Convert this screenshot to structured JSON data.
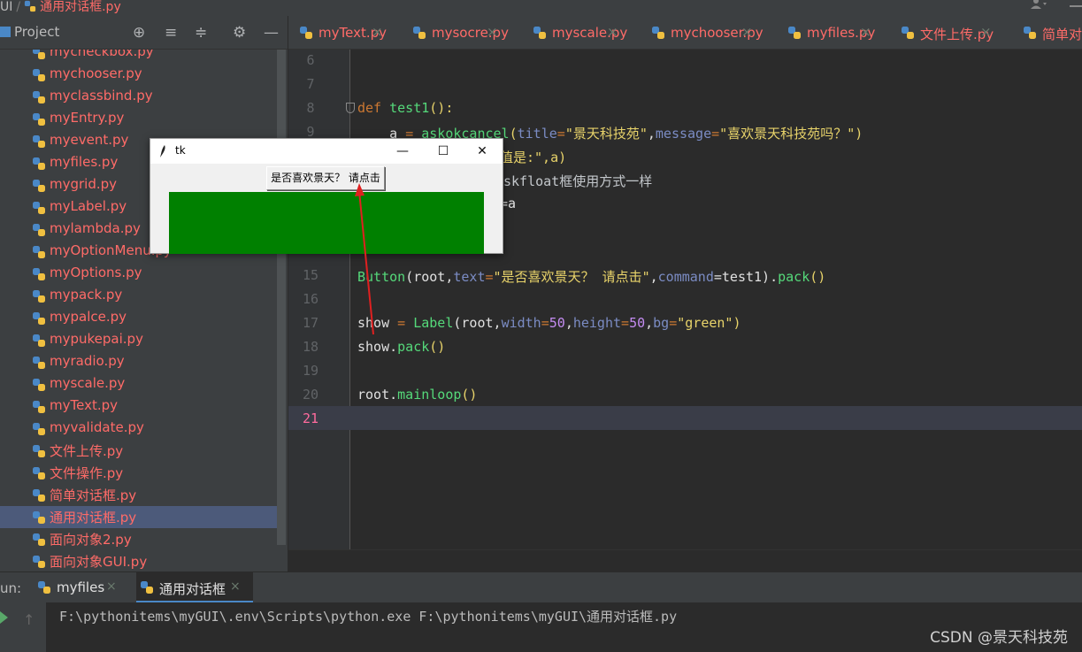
{
  "breadcrumb": {
    "project": "UI",
    "separator": "/",
    "file": "通用对话框.py"
  },
  "project_panel": {
    "title": "Project",
    "files": [
      "mycheckbox.py",
      "mychooser.py",
      "myclassbind.py",
      "myEntry.py",
      "myevent.py",
      "myfiles.py",
      "mygrid.py",
      "myLabel.py",
      "mylambda.py",
      "myOptionMenu.py",
      "myOptions.py",
      "mypack.py",
      "mypalce.py",
      "mypukepai.py",
      "myradio.py",
      "myscale.py",
      "myText.py",
      "myvalidate.py",
      "文件上传.py",
      "文件操作.py",
      "简单对话框.py",
      "通用对话框.py",
      "面向对象2.py",
      "面向对象GUI.py"
    ],
    "selected": "通用对话框.py"
  },
  "editor_tabs": [
    "myText.py",
    "mysocre.py",
    "myscale.py",
    "mychooser.py",
    "myfiles.py",
    "文件上传.py",
    "简单对话"
  ],
  "tab_close_glyph": "×",
  "gutter_lines": [
    "6",
    "7",
    "8",
    "9",
    "15",
    "16",
    "17",
    "18",
    "19",
    "20",
    "21"
  ],
  "current_line": "21",
  "code": {
    "l8_def": "def ",
    "l8_name": "test1",
    "l8_rest": "():",
    "l9_a": "    a ",
    "l9_eq": "= ",
    "l9_fn": "askokcancel",
    "l9_p1": "title",
    "l9_s1": "\"景天科技苑\"",
    "l9_p2": "message",
    "l9_s2": "\"喜欢景天科技苑吗？\"",
    "l10_tail": "值是:\",a)",
    "l11_tail": "skfloat框使用方式一样",
    "l12_tail": "=a",
    "l15_btn": "Button",
    "l15_root": "(root,",
    "l15_p1": "text",
    "l15_s1": "\"是否喜欢景天？ 请点击\"",
    "l15_p2": "command",
    "l15_cmd": "=test1).",
    "l15_pack": "pack",
    "l15_end": "()",
    "l17_show": "show ",
    "l17_eq": "= ",
    "l17_label": "Label",
    "l17_root": "(root,",
    "l17_w": "width",
    "l17_wv": "50",
    "l17_h": "height",
    "l17_hv": "50",
    "l17_bg": "bg",
    "l17_bgv": "\"green\"",
    "l17_end": ")",
    "l18_show": "show.",
    "l18_pack": "pack",
    "l18_end": "()",
    "l20_root": "root.",
    "l20_ml": "mainloop",
    "l20_end": "()"
  },
  "tk_window": {
    "title": "tk",
    "minimize": "—",
    "maximize": "☐",
    "close": "✕",
    "button_label": "是否喜欢景天？ 请点击",
    "label_bg": "#008000"
  },
  "run_panel": {
    "label": "un:",
    "tabs": [
      "myfiles",
      "通用对话框"
    ],
    "active_tab": "通用对话框",
    "command": "F:\\pythonitems\\myGUI\\.env\\Scripts\\python.exe F:\\pythonitems\\myGUI\\通用对话框.py"
  },
  "watermark": "CSDN @景天科技苑",
  "colors": {
    "accent": "#4a88c7",
    "file_modified": "#ff6b68",
    "annotation_arrow": "#e02020"
  }
}
